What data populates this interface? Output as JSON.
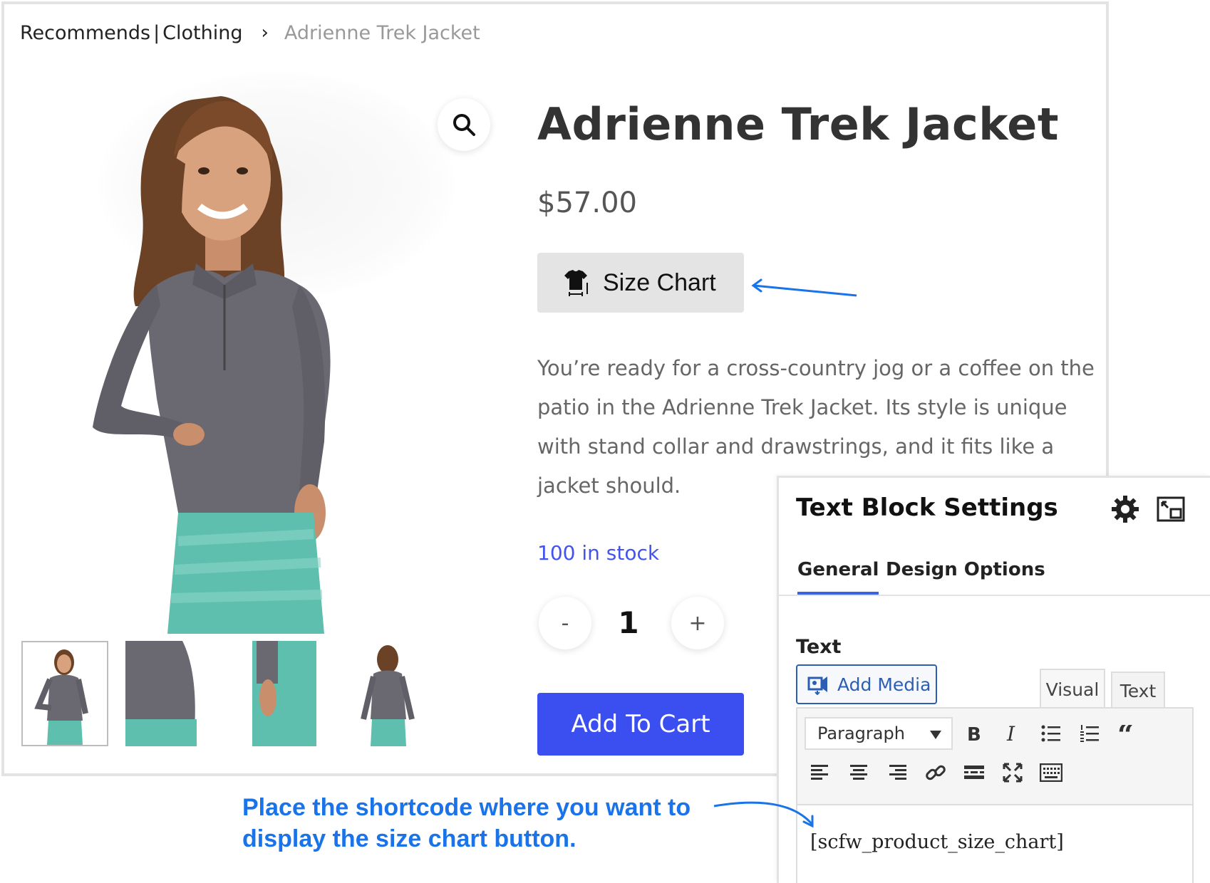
{
  "breadcrumb": {
    "root": "Recommends",
    "separator": "|",
    "category": "Clothing",
    "chevron": "›",
    "current": "Adrienne Trek Jacket"
  },
  "product": {
    "title": "Adrienne Trek Jacket",
    "price": "$57.00",
    "size_chart_label": "Size Chart",
    "size_chart_icon": "shirt-size-icon",
    "description": "You’re ready for a cross-country jog or a coffee on the patio in the Adrienne Trek Jacket. Its style is unique with stand collar and drawstrings, and it fits like a jacket should.",
    "stock": "100 in stock",
    "quantity": "1",
    "qty_minus": "-",
    "qty_plus": "+",
    "add_to_cart": "Add To Cart",
    "zoom_icon": "search-icon",
    "thumbnails": 4
  },
  "settings_panel": {
    "title": "Text Block Settings",
    "tabs": [
      "General",
      "Design Options"
    ],
    "active_tab": "General",
    "field_label": "Text",
    "add_media": "Add Media",
    "editor_tabs": [
      "Visual",
      "Text"
    ],
    "active_editor_tab": "Visual",
    "format_select": "Paragraph",
    "toolbar_icons": [
      "bold-icon",
      "italic-icon",
      "bullet-list-icon",
      "numbered-list-icon",
      "blockquote-icon",
      "align-left-icon",
      "align-center-icon",
      "align-right-icon",
      "link-icon",
      "read-more-icon",
      "fullscreen-icon",
      "toolbar-toggle-icon"
    ],
    "shortcode": "[scfw_product_size_chart]"
  },
  "annotation": {
    "instruction_line1": "Place the shortcode where you want to",
    "instruction_line2": "display the size chart button."
  },
  "colors": {
    "accent_blue": "#3b4ef0",
    "annotation_blue": "#1a73e8",
    "stock_blue": "#4353f0",
    "tab_underline": "#3b62e0"
  }
}
